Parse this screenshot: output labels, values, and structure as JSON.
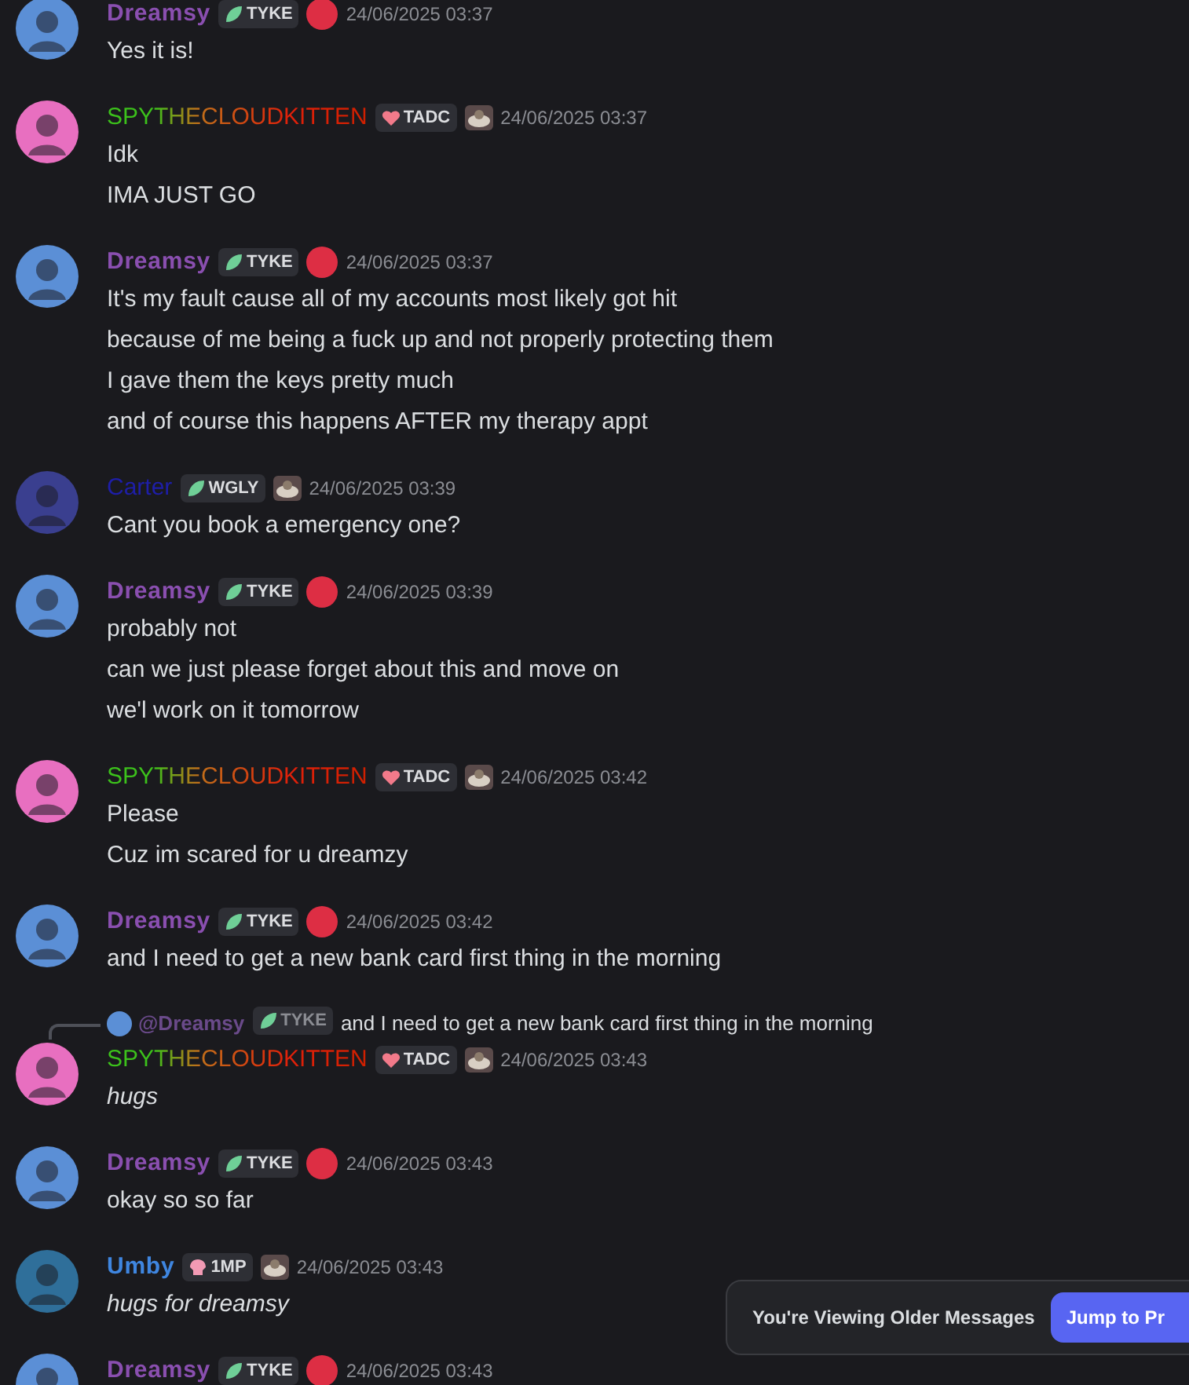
{
  "messages": [
    {
      "kind": "moon",
      "author": "Dreamsy",
      "color": "#8a4fb0",
      "tag": "TYKE",
      "timestamp": "24/06/2025 03:37",
      "italic": false,
      "lines": [
        "Yes it is!"
      ]
    },
    {
      "kind": "kitten",
      "author": "SPYTHECLOUDKITTEN",
      "tag": "TADC",
      "timestamp": "24/06/2025 03:37",
      "italic": false,
      "lines": [
        "Idk",
        "IMA JUST GO"
      ]
    },
    {
      "kind": "moon",
      "author": "Dreamsy",
      "color": "#8a4fb0",
      "tag": "TYKE",
      "timestamp": "24/06/2025 03:37",
      "italic": false,
      "lines": [
        "It's my fault cause all of my accounts most likely got hit",
        "because of me being a fuck up and not properly protecting them",
        "I gave them the keys pretty much",
        "and of course this happens AFTER my therapy appt"
      ]
    },
    {
      "kind": "ghost",
      "author": "Carter",
      "color": "#1e1ea8",
      "tag": "WGLY",
      "timestamp": "24/06/2025 03:39",
      "italic": false,
      "lines": [
        "Cant you book a emergency one?"
      ]
    },
    {
      "kind": "moon",
      "author": "Dreamsy",
      "color": "#8a4fb0",
      "tag": "TYKE",
      "timestamp": "24/06/2025 03:39",
      "italic": false,
      "lines": [
        "probably not",
        "can we just please forget about this and move on",
        "we'l work on it tomorrow"
      ]
    },
    {
      "kind": "kitten",
      "author": "SPYTHECLOUDKITTEN",
      "tag": "TADC",
      "timestamp": "24/06/2025 03:42",
      "italic": false,
      "lines": [
        "Please",
        "Cuz im scared for u dreamzy"
      ]
    },
    {
      "kind": "moon",
      "author": "Dreamsy",
      "color": "#8a4fb0",
      "tag": "TYKE",
      "timestamp": "24/06/2025 03:42",
      "italic": false,
      "lines": [
        "and I need to get a new bank card first thing in the morning"
      ]
    },
    {
      "kind": "kitten",
      "author": "SPYTHECLOUDKITTEN",
      "tag": "TADC",
      "timestamp": "24/06/2025 03:43",
      "italic": true,
      "reply": {
        "mention": "@Dreamsy",
        "tag": "TYKE",
        "text": "and I need to get a new bank card first thing in the morning"
      },
      "lines": [
        "hugs"
      ]
    },
    {
      "kind": "moon",
      "author": "Dreamsy",
      "color": "#8a4fb0",
      "tag": "TYKE",
      "timestamp": "24/06/2025 03:43",
      "italic": false,
      "lines": [
        "okay so so far"
      ]
    },
    {
      "kind": "globe",
      "author": "Umby",
      "color": "#3f86e0",
      "tag": "1MP",
      "timestamp": "24/06/2025 03:43",
      "italic": true,
      "lines": [
        "hugs for dreamsy"
      ]
    },
    {
      "kind": "moon",
      "author": "Dreamsy",
      "color": "#8a4fb0",
      "tag": "TYKE",
      "timestamp": "24/06/2025 03:43"
    }
  ],
  "toast": {
    "text": "You're Viewing Older Messages",
    "button": "Jump to Pr"
  }
}
